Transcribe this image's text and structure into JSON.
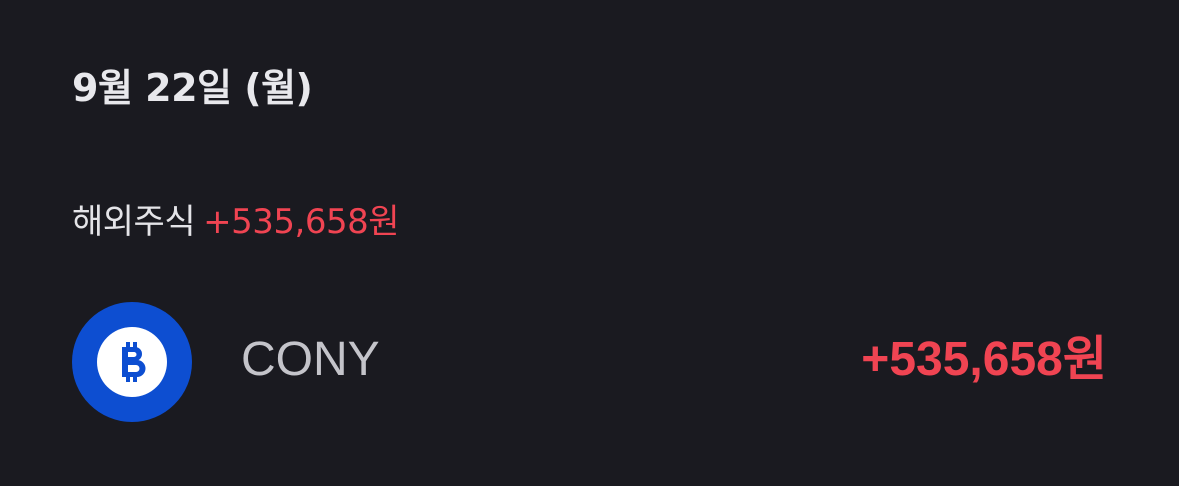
{
  "header": {
    "date": "9월 22일 (월)"
  },
  "section": {
    "label": "해외주식",
    "amount": "+535,658원"
  },
  "items": [
    {
      "icon": "bitcoin-icon",
      "name": "CONY",
      "amount": "+535,658원"
    }
  ],
  "colors": {
    "background": "#1a1a20",
    "gain": "#f04452",
    "logo_bg": "#0d4ed1"
  }
}
